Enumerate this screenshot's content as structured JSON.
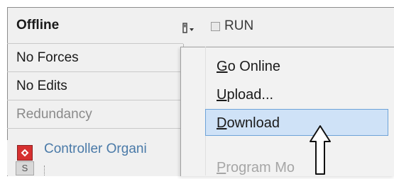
{
  "status": {
    "mode_label": "Offline",
    "forces_label": "No Forces",
    "edits_label": "No Edits",
    "redundancy_label": "Redundancy",
    "run_label": "RUN"
  },
  "organizer": {
    "label": "Controller Organi",
    "tab_label": "S"
  },
  "context_menu": {
    "items": [
      {
        "accel": "G",
        "rest": "o Online"
      },
      {
        "accel": "U",
        "rest": "pload..."
      },
      {
        "accel": "D",
        "rest": "ownload"
      },
      {
        "accel": "P",
        "rest": "rogram Mo"
      }
    ]
  },
  "colors": {
    "highlight": "#cfe2f7",
    "organizer_icon": "#d63030",
    "organizer_text": "#4a7aa8"
  }
}
